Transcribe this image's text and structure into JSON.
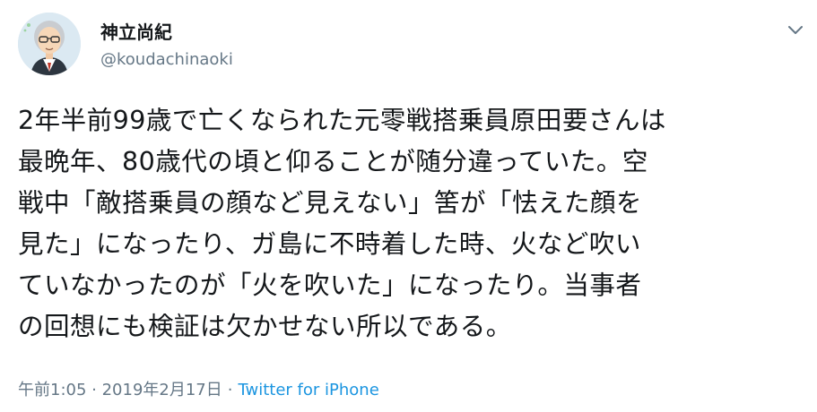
{
  "author": {
    "display_name": "神立尚紀",
    "handle": "@koudachinaoki",
    "avatar_icon": "user-avatar-illustration"
  },
  "menu_icon": "chevron-down-icon",
  "tweet": {
    "lines": [
      "2年半前99歳で亡くなられた元零戦搭乗員原田要さんは",
      "最晩年、80歳代の頃と仰ることが随分違っていた。空",
      "戦中「敵搭乗員の顔など見えない」筈が「怯えた顔を",
      "見た」になったり、ガ島に不時着した時、火など吹い",
      "ていなかったのが「火を吹いた」になったり。当事者",
      "の回想にも検証は欠かせない所以である。"
    ]
  },
  "meta": {
    "timestamp": "午前1:05 · 2019年2月17日",
    "separator": "·",
    "source": "Twitter for iPhone"
  },
  "colors": {
    "text": "#14171a",
    "secondary": "#657786",
    "link": "#1b95e0"
  }
}
